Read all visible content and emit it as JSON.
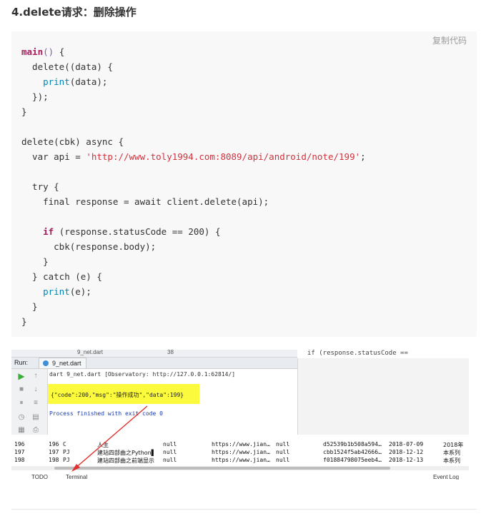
{
  "heading": "4.delete请求：删除操作",
  "copy_label": "复制代码",
  "code": [
    [
      "kw:main",
      "fn:()",
      "t: {"
    ],
    [
      "t:  delete((data) {"
    ],
    [
      "t:    ",
      "bi:print",
      "t:(data);"
    ],
    [
      "t:  });"
    ],
    [
      "t:}"
    ],
    [
      "t:"
    ],
    [
      "t:delete(cbk) async {"
    ],
    [
      "t:  var api = ",
      "str:'http://www.toly1994.com:8089/api/android/note/199'",
      "t:;"
    ],
    [
      "t:"
    ],
    [
      "t:  try {"
    ],
    [
      "t:    final response = await client.delete(api);"
    ],
    [
      "t:"
    ],
    [
      "t:    ",
      "kw:if",
      "t: (response.statusCode == 200) {"
    ],
    [
      "t:      cbk(response.body);"
    ],
    [
      "t:    }"
    ],
    [
      "t:  } catch (e) {"
    ],
    [
      "t:    ",
      "bi:print",
      "t:(e);"
    ],
    [
      "t:  }"
    ],
    [
      "t:}"
    ]
  ],
  "ide": {
    "top_tab": "9_net.dart",
    "top_num": "38",
    "right_code": "if (response.statusCode ==",
    "run_label": "Run:",
    "run_tab": "9_net.dart",
    "cmd_line": "dart 9_net.dart [Observatory: http://127.0.0.1:62814/]",
    "output_line": "{\"code\":200,\"msg\":\"操作成功\",\"data\":199}",
    "finished_line": "Process finished with exit code 0",
    "rows": [
      {
        "n": "196",
        "id": "196",
        "t": "C",
        "title": "人生",
        "v": "null",
        "url": "https://www.jian…",
        "v2": "null",
        "hash": "d52539b1b508a594…",
        "date": "2018-07-09",
        "extra": "2018年"
      },
      {
        "n": "197",
        "id": "197",
        "t": "PJ",
        "title": "建站四部曲之Python▌",
        "v": "null",
        "url": "https://www.jian…",
        "v2": "null",
        "hash": "cbb1524f5ab42666…",
        "date": "2018-12-12",
        "extra": "本系列"
      },
      {
        "n": "198",
        "id": "198",
        "t": "PJ",
        "title": "建站四部曲之前端显示",
        "v": "null",
        "url": "https://www.jian…",
        "v2": "null",
        "hash": "f0188479807​5eeb4…",
        "date": "2018-12-13",
        "extra": "本系列"
      }
    ],
    "status_todo": "TODO",
    "status_terminal": "Terminal",
    "status_eventlog": "Event Log"
  }
}
